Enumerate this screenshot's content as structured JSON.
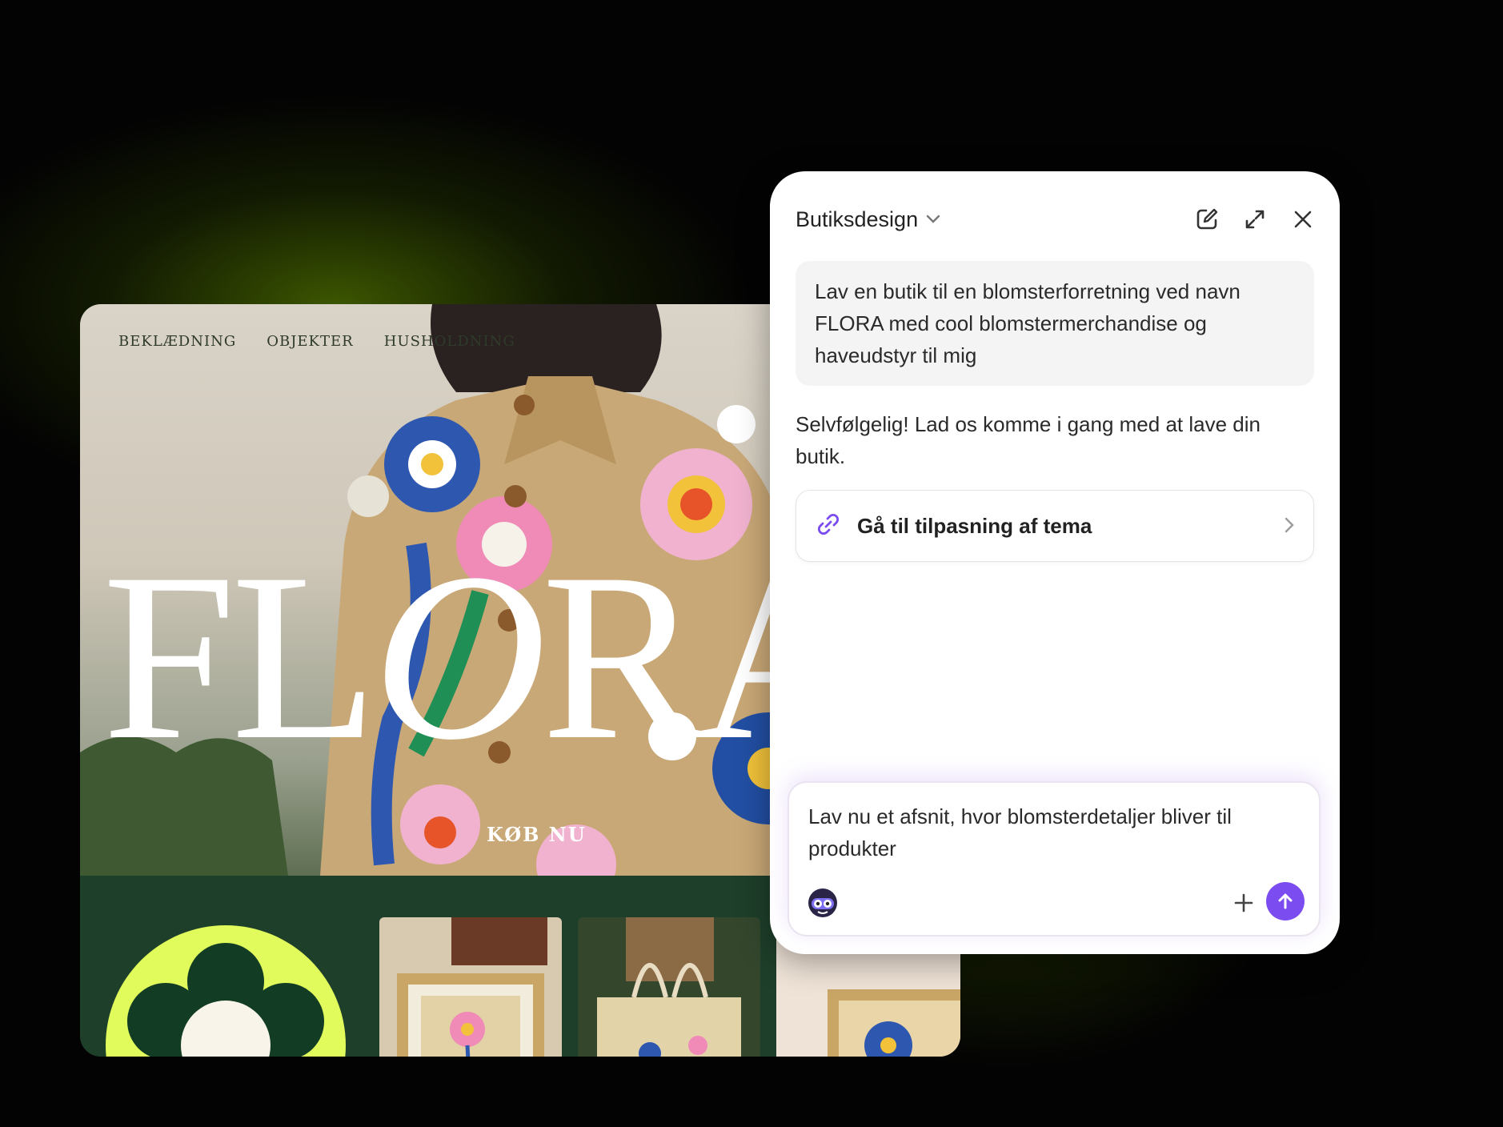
{
  "storefront": {
    "nav": [
      "BEKLÆDNING",
      "OBJEKTER",
      "HUSHOLDNING"
    ],
    "brand_parts": [
      "FL",
      "O",
      "RA"
    ],
    "cta": "KØB NU"
  },
  "chat": {
    "title": "Butiksdesign",
    "header_icons": [
      "edit-icon",
      "expand-icon",
      "close-icon"
    ],
    "user_message": "Lav en butik til en blomsterforretning ved navn FLORA med cool blomstermerchandise og haveudstyr til mig",
    "assistant_message": "Selvfølgelig! Lad os komme i gang med at lave din butik.",
    "link_label": "Gå til tilpasning af tema",
    "composer_text": "Lav nu et afsnit, hvor blomsterdetaljer bliver til produkter"
  },
  "colors": {
    "accent": "#7b4cf0",
    "store_green": "#1e3f2a",
    "lime": "#e2fb5c"
  }
}
